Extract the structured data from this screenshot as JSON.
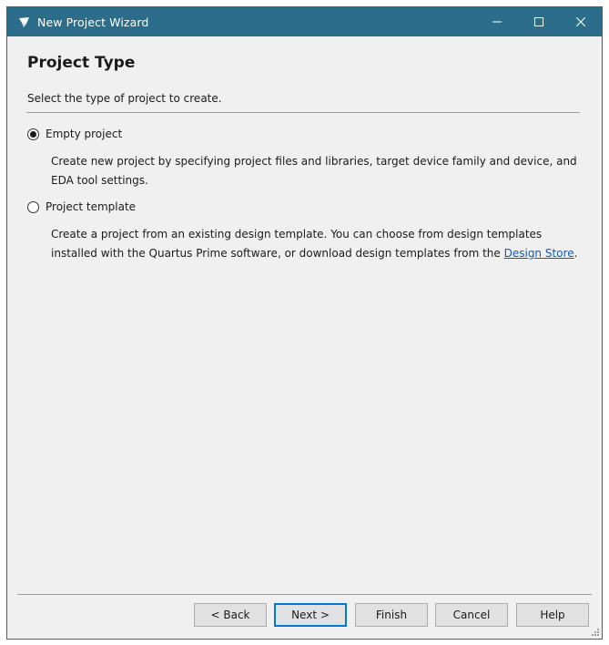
{
  "window": {
    "title": "New Project Wizard",
    "accent_color": "#2b6d8b"
  },
  "page": {
    "title": "Project Type",
    "subtitle": "Select the type of project to create."
  },
  "options": [
    {
      "label": "Empty project",
      "selected": true,
      "description": "Create new project by specifying project files and libraries, target device family and device, and EDA tool settings."
    },
    {
      "label": "Project template",
      "selected": false,
      "description_prefix": "Create a project from an existing design template. You can choose from design templates installed with the Quartus Prime software, or download design templates from the ",
      "link_text": "Design Store",
      "description_suffix": "."
    }
  ],
  "buttons": {
    "back": "< Back",
    "next": "Next >",
    "finish": "Finish",
    "cancel": "Cancel",
    "help": "Help"
  }
}
